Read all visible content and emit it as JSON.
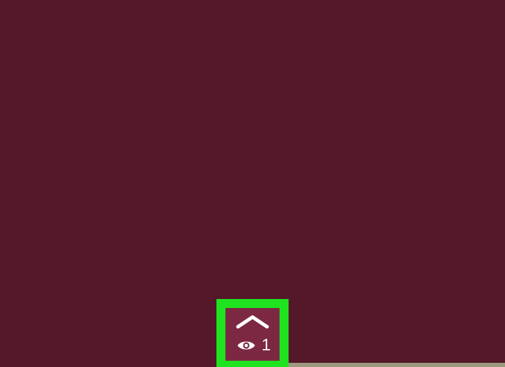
{
  "colors": {
    "background": "#55172a",
    "widget_background": "#7c2843",
    "highlight": "#1fe31f",
    "bottom_strip": "#9d9a80",
    "icon": "#ffffff"
  },
  "viewer_panel": {
    "expand_icon": "chevron-up-icon",
    "viewer_icon": "eye-icon",
    "viewer_count": "1"
  }
}
